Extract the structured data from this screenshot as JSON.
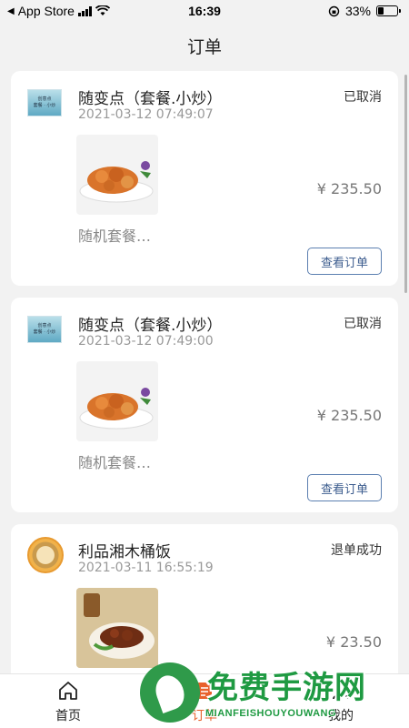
{
  "status_bar": {
    "back_app": "App Store",
    "time": "16:39",
    "battery": "33%",
    "battery_level": 0.33
  },
  "header": {
    "title": "订单"
  },
  "orders": [
    {
      "shop": "随变点（套餐.小炒）",
      "logo_text": [
        "创意点",
        "套餐 · 小炒"
      ],
      "time": "2021-03-12 07:49:07",
      "status": "已取消",
      "price": "¥ 235.50",
      "desc": "随机套餐…",
      "button": "查看订单"
    },
    {
      "shop": "随变点（套餐.小炒）",
      "logo_text": [
        "创意点",
        "套餐 · 小炒"
      ],
      "time": "2021-03-12 07:49:00",
      "status": "已取消",
      "price": "¥ 235.50",
      "desc": "随机套餐…",
      "button": "查看订单"
    },
    {
      "shop": "利品湘木桶饭",
      "time": "2021-03-11 16:55:19",
      "status": "退单成功",
      "price": "¥ 23.50"
    }
  ],
  "tabbar": {
    "items": [
      {
        "label": "首页",
        "icon": "home-icon"
      },
      {
        "label": "订单",
        "icon": "order-icon"
      },
      {
        "label": "我的",
        "icon": "profile-icon"
      }
    ]
  },
  "watermark": {
    "title": "免费手游网",
    "subtitle": "MIANFEISHOUYOUWANG"
  },
  "colors": {
    "accent": "#e8612c",
    "button_border": "#5b7fb0",
    "watermark": "#1f9a42"
  }
}
